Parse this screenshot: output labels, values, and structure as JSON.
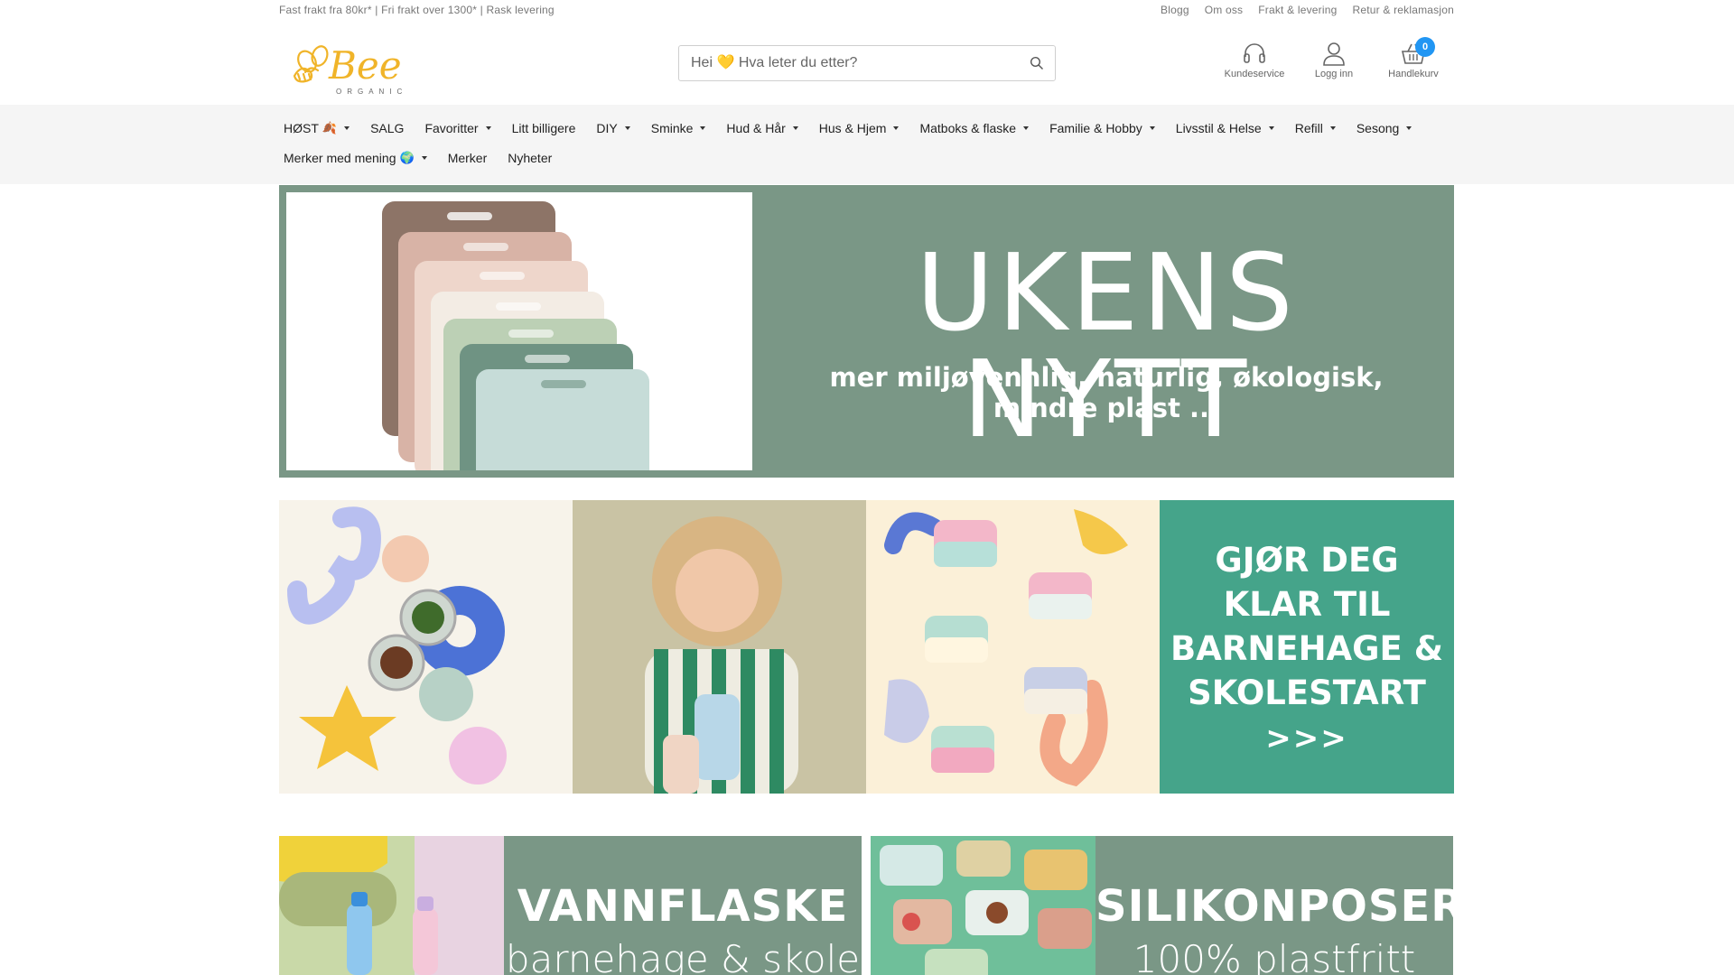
{
  "topbar": {
    "promo": "Fast frakt fra 80kr* | Fri frakt over 1300* | Rask levering",
    "links": [
      "Blogg",
      "Om oss",
      "Frakt & levering",
      "Retur & reklamasjon"
    ]
  },
  "header": {
    "logo_text": "Bee",
    "logo_sub": "ORGANIC",
    "search_placeholder": "Hei 💛 Hva leter du etter?",
    "icons": {
      "support_label": "Kundeservice",
      "login_label": "Logg inn",
      "cart_label": "Handlekurv",
      "cart_count": "0"
    }
  },
  "nav": {
    "row1": [
      {
        "label": "HØST",
        "emoji": "🍂",
        "dropdown": true
      },
      {
        "label": "SALG",
        "dropdown": false
      },
      {
        "label": "Favoritter",
        "dropdown": true
      },
      {
        "label": "Litt billigere",
        "dropdown": false
      },
      {
        "label": "DIY",
        "dropdown": true
      },
      {
        "label": "Sminke",
        "dropdown": true
      },
      {
        "label": "Hud & Hår",
        "dropdown": true
      },
      {
        "label": "Hus & Hjem",
        "dropdown": true
      },
      {
        "label": "Matboks & flaske",
        "dropdown": true
      },
      {
        "label": "Familie & Hobby",
        "dropdown": true
      },
      {
        "label": "Livsstil & Helse",
        "dropdown": true
      },
      {
        "label": "Refill",
        "dropdown": true
      },
      {
        "label": "Sesong",
        "dropdown": true
      }
    ],
    "row2": [
      {
        "label": "Merker med mening",
        "emoji": "🌍",
        "dropdown": true
      },
      {
        "label": "Merker",
        "dropdown": false
      },
      {
        "label": "Nyheter",
        "dropdown": false
      }
    ]
  },
  "banners": {
    "weekly": {
      "title": "UKENS NYTT",
      "subtitle": "mer miljøvennlig, naturlig, økologisk, mindre plast ..."
    },
    "school": {
      "lines": [
        "GJØR DEG",
        "KLAR TIL",
        "BARNEHAGE &",
        "SKOLESTART"
      ],
      "arrows": ">>>"
    },
    "bottle": {
      "title": "VANNFLASKE",
      "subtitle": "barnehage & skole"
    },
    "silicone": {
      "title": "SILIKONPOSER",
      "subtitle": "100% plastfritt"
    }
  },
  "colors": {
    "sage": "#7a9786",
    "teal": "#45a48a",
    "badge": "#2196f3",
    "logo": "#f0b429"
  }
}
